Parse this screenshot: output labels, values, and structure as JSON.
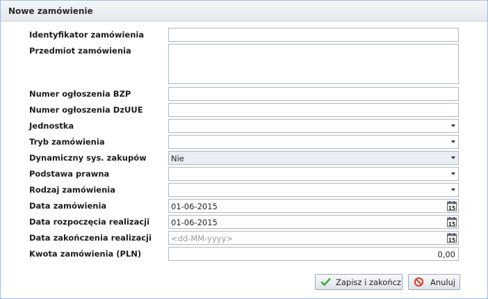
{
  "dialog": {
    "title": "Nowe zamówienie"
  },
  "fields": {
    "identyfikator": {
      "label": "Identyfikator zamówienia",
      "value": ""
    },
    "przedmiot": {
      "label": "Przedmiot zamówienia",
      "value": ""
    },
    "bzp": {
      "label": "Numer ogłoszenia BZP",
      "value": ""
    },
    "dzuue": {
      "label": "Numer ogłoszenia DzUUE",
      "value": ""
    },
    "jednostka": {
      "label": "Jednostka",
      "value": ""
    },
    "tryb": {
      "label": "Tryb zamówienia",
      "value": ""
    },
    "dynamiczny": {
      "label": "Dynamiczny sys. zakupów",
      "value": "Nie"
    },
    "podstawa": {
      "label": "Podstawa prawna",
      "value": ""
    },
    "rodzaj": {
      "label": "Rodzaj zamówienia",
      "value": ""
    },
    "data_zam": {
      "label": "Data zamówienia",
      "value": "01-06-2015"
    },
    "data_rozp": {
      "label": "Data rozpoczęcia realizacji",
      "value": "01-06-2015"
    },
    "data_zak": {
      "label": "Data zakończenia realizacji",
      "value": "",
      "placeholder": "<dd-MM-yyyy>"
    },
    "kwota": {
      "label": "Kwota zamówienia (PLN)",
      "value": "0,00"
    }
  },
  "calendar_icon_text": "15",
  "buttons": {
    "save": "Zapisz i zakończ",
    "cancel": "Anuluj"
  },
  "icons": {
    "combo_arrow": "chevron-down-icon",
    "calendar": "calendar-icon",
    "save": "check-icon",
    "cancel": "cancel-icon"
  }
}
